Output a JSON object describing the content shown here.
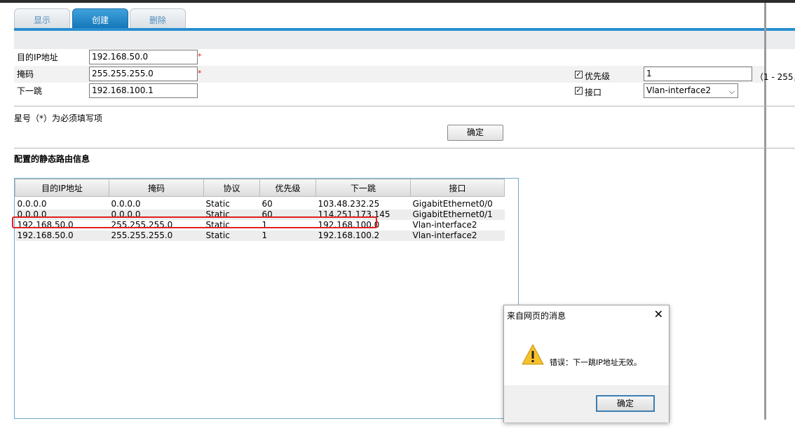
{
  "tabs": [
    {
      "label": "显示",
      "active": false
    },
    {
      "label": "创建",
      "active": true
    },
    {
      "label": "删除",
      "active": false
    }
  ],
  "form": {
    "dest_ip": {
      "label": "目的IP地址",
      "value": "192.168.50.0",
      "required_mark": "*"
    },
    "mask": {
      "label": "掩码",
      "value": "255.255.255.0",
      "required_mark": "*"
    },
    "next_hop": {
      "label": "下一跳",
      "value": "192.168.100.1"
    },
    "priority": {
      "label": "优先级",
      "checked": true,
      "value": "1",
      "range_hint": "（1 - 255，"
    },
    "interface": {
      "label": "接口",
      "checked": true,
      "selected": "Vlan-interface2"
    },
    "required_note": "星号（*）为必须填写项",
    "submit_label": "确定"
  },
  "section_title": "配置的静态路由信息",
  "routes_table": {
    "columns": [
      "目的IP地址",
      "掩码",
      "协议",
      "优先级",
      "下一跳",
      "接口"
    ],
    "rows": [
      [
        "0.0.0.0",
        "0.0.0.0",
        "Static",
        "60",
        "103.48.232.25",
        "GigabitEthernet0/0"
      ],
      [
        "0.0.0.0",
        "0.0.0.0",
        "Static",
        "60",
        "114.251.173.145",
        "GigabitEthernet0/1"
      ],
      [
        "192.168.50.0",
        "255.255.255.0",
        "Static",
        "1",
        "192.168.100.0",
        "Vlan-interface2"
      ],
      [
        "192.168.50.0",
        "255.255.255.0",
        "Static",
        "1",
        "192.168.100.2",
        "Vlan-interface2"
      ]
    ],
    "highlighted_row": 2
  },
  "dialog": {
    "title": "来自网页的消息",
    "message": "错误：下一跳IP地址无效。",
    "ok_label": "确定",
    "icon": "warning-icon"
  },
  "colors": {
    "accent": "#2a8ed0",
    "highlight": "#e02020",
    "required": "#e02020"
  }
}
